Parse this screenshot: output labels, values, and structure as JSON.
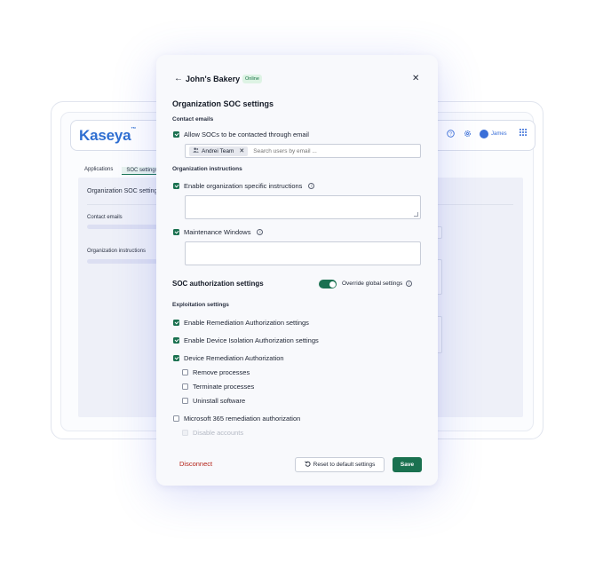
{
  "background": {
    "logo": "Kaseya",
    "logo_mark": "™",
    "header": {
      "user": "James"
    },
    "tabs": [
      "Applications",
      "SOC settings"
    ],
    "panel_title": "Organization SOC settings",
    "labels": [
      "Contact emails",
      "Organization instructions"
    ]
  },
  "modal": {
    "title": "John's Bakery",
    "status_badge": "Online",
    "section_title": "Organization SOC settings",
    "contact": {
      "label": "Contact emails",
      "allow_checkbox": {
        "label": "Allow SOCs to be contacted through email",
        "checked": true
      },
      "chip": "Andrei Team",
      "search_placeholder": "Search users by email ..."
    },
    "instructions": {
      "label": "Organization instructions",
      "enable_checkbox": {
        "label": "Enable organization specific instructions",
        "checked": true
      },
      "instructions_value": "",
      "maintenance_checkbox": {
        "label": "Maintenance Windows",
        "checked": true
      },
      "maintenance_value": ""
    },
    "auth": {
      "title": "SOC authorization settings",
      "override_label": "Override global settings",
      "override_on": true
    },
    "exploitation": {
      "label": "Exploitation settings",
      "items": [
        {
          "label": "Enable Remediation Authorization settings",
          "checked": true
        },
        {
          "label": "Enable Device Isolation Authorization settings",
          "checked": true
        },
        {
          "label": "Device Remediation Authorization",
          "checked": true
        }
      ],
      "sub_items": [
        {
          "label": "Remove processes",
          "checked": false
        },
        {
          "label": "Terminate processes",
          "checked": false
        },
        {
          "label": "Uninstall software",
          "checked": false
        }
      ],
      "m365": {
        "label": "Microsoft 365 remediation authorization",
        "checked": false
      },
      "m365_sub": {
        "label": "Disable accounts",
        "disabled": true
      }
    },
    "footer": {
      "disconnect": "Disconnect",
      "reset": "Reset to default settings",
      "save": "Save"
    }
  },
  "colors": {
    "primary_green": "#1a7150",
    "danger": "#b42318",
    "brand_blue": "#2f6fd1",
    "badge_bg": "#ddf3e4"
  }
}
